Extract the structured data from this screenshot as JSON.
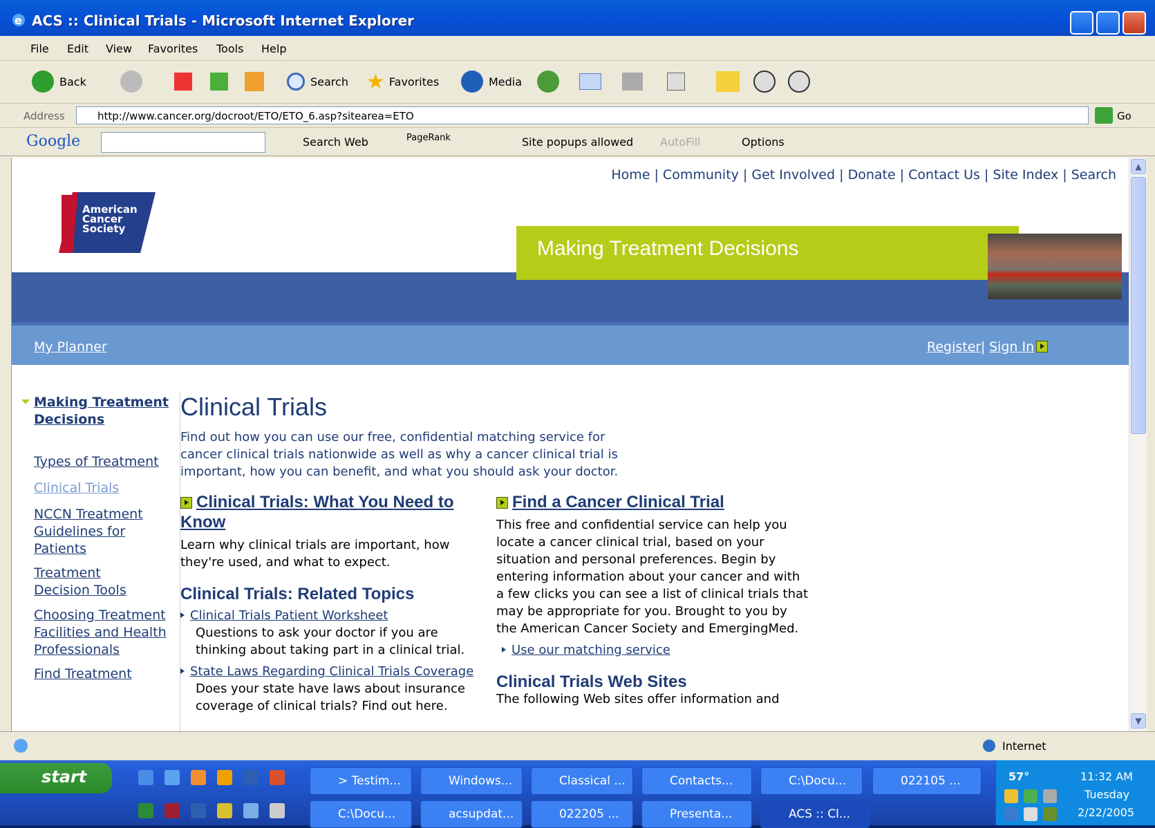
{
  "window": {
    "title": "ACS :: Clinical Trials - Microsoft Internet Explorer"
  },
  "menu": [
    "File",
    "Edit",
    "View",
    "Favorites",
    "Tools",
    "Help"
  ],
  "toolbar": {
    "back": "Back",
    "search": "Search",
    "favorites": "Favorites",
    "media": "Media"
  },
  "address": {
    "label": "Address",
    "url": "http://www.cancer.org/docroot/ETO/ETO_6.asp?sitearea=ETO",
    "go": "Go"
  },
  "google_bar": {
    "logo": "Google",
    "search_web": "Search Web",
    "pagerank": "PageRank",
    "popups": "Site popups allowed",
    "autofill": "AutoFill",
    "options": "Options"
  },
  "site": {
    "top_nav": [
      "Home",
      "Community",
      "Get Involved",
      "Donate",
      "Contact Us",
      "Site Index",
      "Search"
    ],
    "logo_text": "American Cancer Society",
    "banner": "Making Treatment Decisions",
    "my_planner": "My Planner",
    "register": "Register",
    "sign_in": "Sign In"
  },
  "left_nav": {
    "section": "Making Treatment Decisions",
    "items": [
      "Types of Treatment",
      "Clinical Trials",
      "NCCN Treatment Guidelines for Patients",
      "Treatment Decision Tools",
      "Choosing Treatment Facilities and Health Professionals",
      "Find Treatment"
    ]
  },
  "main": {
    "title": "Clinical Trials",
    "intro": "Find out how you can use our free, confidential matching service for cancer clinical trials nationwide as well as why a cancer clinical trial is important, how you can benefit, and what you should ask your doctor.",
    "need_to_know": {
      "heading": "Clinical Trials: What You Need to Know",
      "text": "Learn why clinical trials are important, how they're used, and what to expect."
    },
    "related": {
      "heading": "Clinical Trials: Related Topics",
      "items": [
        {
          "link": "Clinical Trials Patient Worksheet",
          "desc": "Questions to ask your doctor if you are thinking about taking part in a clinical trial."
        },
        {
          "link": "State Laws Regarding Clinical Trials Coverage",
          "desc": "Does your state have laws about insurance coverage of clinical trials? Find out here."
        }
      ]
    },
    "find_trial": {
      "heading": "Find a Cancer Clinical Trial",
      "text": "This free and confidential service can help you locate a cancer clinical trial, based on your situation and personal preferences. Begin by entering information about your cancer and with a few clicks you can see a list of clinical trials that may be appropriate for you. Brought to you by the American Cancer Society and EmergingMed.",
      "link": "Use our matching service"
    },
    "web_sites": {
      "heading": "Clinical Trials Web Sites",
      "text": "The following Web sites offer information and"
    }
  },
  "status": {
    "zone": "Internet"
  },
  "taskbar": {
    "start": "start",
    "row1": [
      "> Testim...",
      "Windows...",
      "Classical ...",
      "Contacts...",
      "C:\\Docu...",
      "022105 ..."
    ],
    "row2": [
      "C:\\Docu...",
      "acsupdat...",
      "022205 ...",
      "Presenta...",
      "ACS :: Cl..."
    ],
    "temp": "57°",
    "time": "11:32 AM",
    "day": "Tuesday",
    "date": "2/22/2005"
  },
  "colors": {
    "accent": "#b5cc18",
    "navy": "#1f3c76",
    "band": "#3d60a4"
  }
}
